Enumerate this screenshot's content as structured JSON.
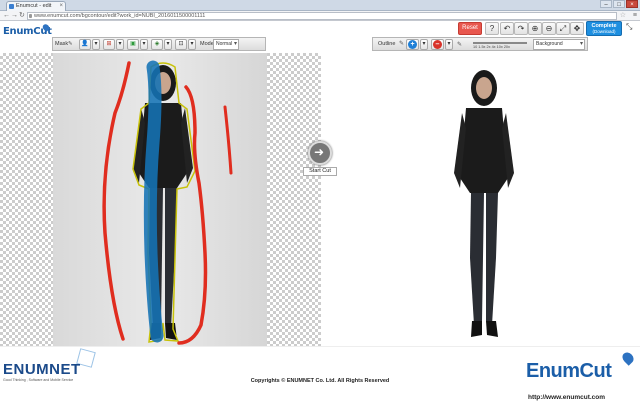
{
  "browser": {
    "tab_title": "Enumcut - edit",
    "address": "www.enumcut.com/bgcontour/edit?work_id=NUBI_2016011500001111"
  },
  "app": {
    "logo_text": "EnumCut",
    "reset_label": "Reset",
    "complete_label": "Complete",
    "complete_sub": "(Download)",
    "accent_color": "#1e8fe0"
  },
  "left_toolbar": {
    "mask_label": "Mask",
    "mode_label": "Mode",
    "mode_value": "Normal"
  },
  "right_toolbar": {
    "outline_label": "Outline",
    "slider_ticks": "10  1.5x  2x  4x  10x  20x",
    "background_value": "Background"
  },
  "canvas": {
    "start_cut_label": "Start Cut"
  },
  "footer": {
    "enumnet_logo": "ENUMNET",
    "enumnet_tagline": "Good Thinking , Software and Mobile Service",
    "copyright": "Copyrights © ENUMNET Co. Ltd. All Rights Reserved",
    "enumcut_logo": "EnumCut",
    "url": "http://www.enumcut.com"
  }
}
